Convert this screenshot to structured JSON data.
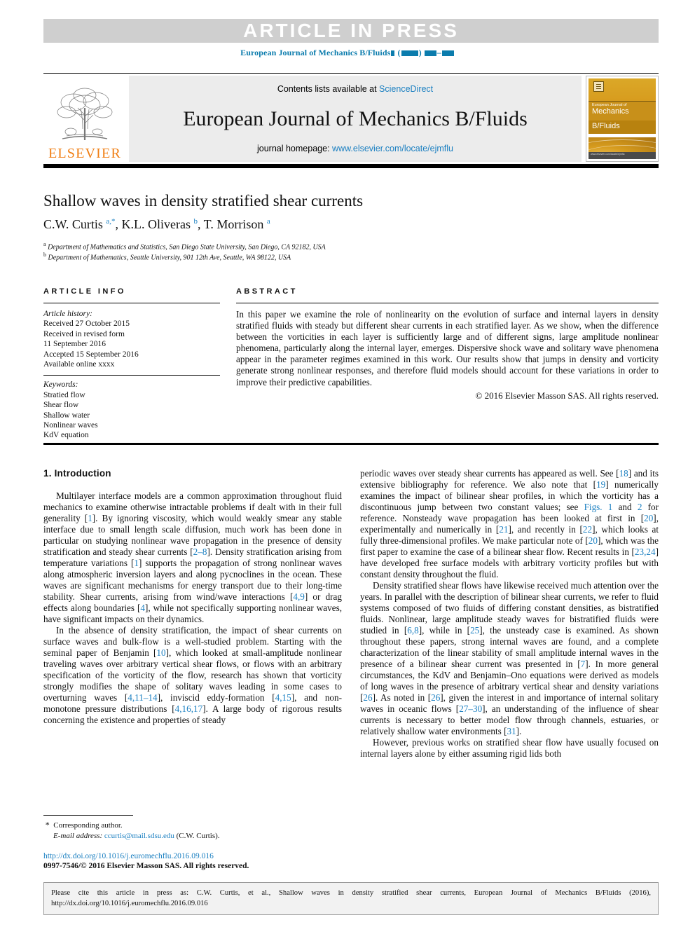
{
  "banner": {
    "text": "ARTICLE  IN  PRESS"
  },
  "running_head": {
    "journal": "European Journal of Mechanics B/Fluids",
    "year_placeholder": "( )",
    "pages_placeholder": "–"
  },
  "journal_header": {
    "contents_prefix": "Contents lists available at ",
    "contents_link": "ScienceDirect",
    "title": "European Journal of Mechanics B/Fluids",
    "homepage_prefix": "journal homepage: ",
    "homepage_url": "www.elsevier.com/locate/ejmflu",
    "publisher": "ELSEVIER",
    "cover": {
      "line1": "European Journal of",
      "line2": "Mechanics",
      "line3": "B/Fluids",
      "footer": "www.elsevier.com/locate/ejmflu"
    }
  },
  "article": {
    "title": "Shallow waves in density stratified shear currents",
    "authors_html": "C.W. Curtis <sup>a,*</sup>, K.L. Oliveras <sup>b</sup>, T. Morrison <sup>a</sup>",
    "affiliation_a": "Department of Mathematics and Statistics, San Diego State University, San Diego, CA 92182, USA",
    "affiliation_b": "Department of Mathematics, Seattle University, 901 12th Ave, Seattle, WA 98122, USA",
    "affiliation_a_mark": "a",
    "affiliation_b_mark": "b"
  },
  "article_info": {
    "heading": "ARTICLE INFO",
    "history_label": "Article history:",
    "history": [
      "Received 27 October 2015",
      "Received in revised form",
      "11 September 2016",
      "Accepted 15 September 2016",
      "Available online xxxx"
    ],
    "keywords_label": "Keywords:",
    "keywords": [
      "Stratied flow",
      "Shear flow",
      "Shallow water",
      "Nonlinear waves",
      "KdV equation"
    ]
  },
  "abstract": {
    "heading": "ABSTRACT",
    "body": "In this paper we examine the role of nonlinearity on the evolution of surface and internal layers in density stratified fluids with steady but different shear currents in each stratified layer. As we show, when the difference between the vorticities in each layer is sufficiently large and of different signs, large amplitude nonlinear phenomena, particularly along the internal layer, emerges. Dispersive shock wave and solitary wave phenomena appear in the parameter regimes examined in this work. Our results show that jumps in density and vorticity generate strong nonlinear responses, and therefore fluid models should account for these variations in order to improve their predictive capabilities.",
    "copyright": "© 2016 Elsevier Masson SAS. All rights reserved."
  },
  "body": {
    "section_number_title": "1. Introduction",
    "left_paragraph_1_html": "Multilayer interface models are a common approximation throughout fluid mechanics to examine otherwise intractable problems if dealt with in their full generality [<span class=\"ref\">1</span>]. By ignoring viscosity, which would weakly smear any stable interface due to small length scale diffusion, much work has been done in particular on studying nonlinear wave propagation in the presence of density stratification and steady shear currents [<span class=\"ref\">2–8</span>]. Density stratification arising from temperature variations [<span class=\"ref\">1</span>] supports the propagation of strong nonlinear waves along atmospheric inversion layers and along pycnoclines in the ocean. These waves are significant mechanisms for energy transport due to their long-time stability. Shear currents, arising from wind/wave interactions [<span class=\"ref\">4,9</span>] or drag effects along boundaries [<span class=\"ref\">4</span>], while not specifically supporting nonlinear waves, have significant impacts on their dynamics.",
    "left_paragraph_2_html": "In the absence of density stratification, the impact of shear currents on surface waves and bulk-flow is a well-studied problem. Starting with the seminal paper of Benjamin [<span class=\"ref\">10</span>], which looked at small-amplitude nonlinear traveling waves over arbitrary vertical shear flows, or flows with an arbitrary specification of the vorticity of the flow, research has shown that vorticity strongly modifies the shape of solitary waves leading in some cases to overturning waves [<span class=\"ref\">4,11–14</span>], inviscid eddy-formation [<span class=\"ref\">4,15</span>], and non-monotone pressure distributions [<span class=\"ref\">4,16,17</span>]. A large body of rigorous results concerning the existence and properties of steady",
    "right_paragraph_1_html": "periodic waves over steady shear currents has appeared as well. See [<span class=\"ref\">18</span>] and its extensive bibliography for reference. We also note that [<span class=\"ref\">19</span>] numerically examines the impact of bilinear shear profiles, in which the vorticity has a discontinuous jump between two constant values; see <span class=\"ref\">Figs. 1</span> and <span class=\"ref\">2</span> for reference. Nonsteady wave propagation has been looked at first in [<span class=\"ref\">20</span>], experimentally and numerically in [<span class=\"ref\">21</span>], and recently in [<span class=\"ref\">22</span>], which looks at fully three-dimensional profiles. We make particular note of [<span class=\"ref\">20</span>], which was the first paper to examine the case of a bilinear shear flow. Recent results in [<span class=\"ref\">23,24</span>] have developed free surface models with arbitrary vorticity profiles but with constant density throughout the fluid.",
    "right_paragraph_2_html": "Density stratified shear flows have likewise received much attention over the years. In parallel with the description of bilinear shear currents, we refer to fluid systems composed of two fluids of differing constant densities, as bistratified fluids. Nonlinear, large amplitude steady waves for bistratified fluids were studied in [<span class=\"ref\">6,8</span>], while in [<span class=\"ref\">25</span>], the unsteady case is examined. As shown throughout these papers, strong internal waves are found, and a complete characterization of the linear stability of small amplitude internal waves in the presence of a bilinear shear current was presented in [<span class=\"ref\">7</span>]. In more general circumstances, the KdV and Benjamin–Ono equations were derived as models of long waves in the presence of arbitrary vertical shear and density variations [<span class=\"ref\">26</span>]. As noted in [<span class=\"ref\">26</span>], given the interest in and importance of internal solitary waves in oceanic flows [<span class=\"ref\">27–30</span>], an understanding of the influence of shear currents is necessary to better model flow through channels, estuaries, or relatively shallow water environments [<span class=\"ref\">31</span>].",
    "right_paragraph_3_html": "However, previous works on stratified shear flow have usually focused on internal layers alone by either assuming rigid lids both"
  },
  "footnote": {
    "corresponding": "Corresponding author.",
    "email_label": "E-mail address:",
    "email": "ccurtis@mail.sdsu.edu",
    "email_owner": "(C.W. Curtis).",
    "doi_url": "http://dx.doi.org/10.1016/j.euromechflu.2016.09.016",
    "issn_copyright": "0997-7546/© 2016 Elsevier Masson SAS. All rights reserved."
  },
  "citation_box": {
    "text": "Please cite this article in press as: C.W. Curtis, et al., Shallow waves in density stratified shear currents, European Journal of Mechanics B/Fluids (2016), http://dx.doi.org/10.1016/j.euromechflu.2016.09.016"
  },
  "colors": {
    "link": "#1a7fc1",
    "running_head": "#0b7cad",
    "elsevier_orange": "#f07e13",
    "banner_bg": "#cfcfcf"
  }
}
